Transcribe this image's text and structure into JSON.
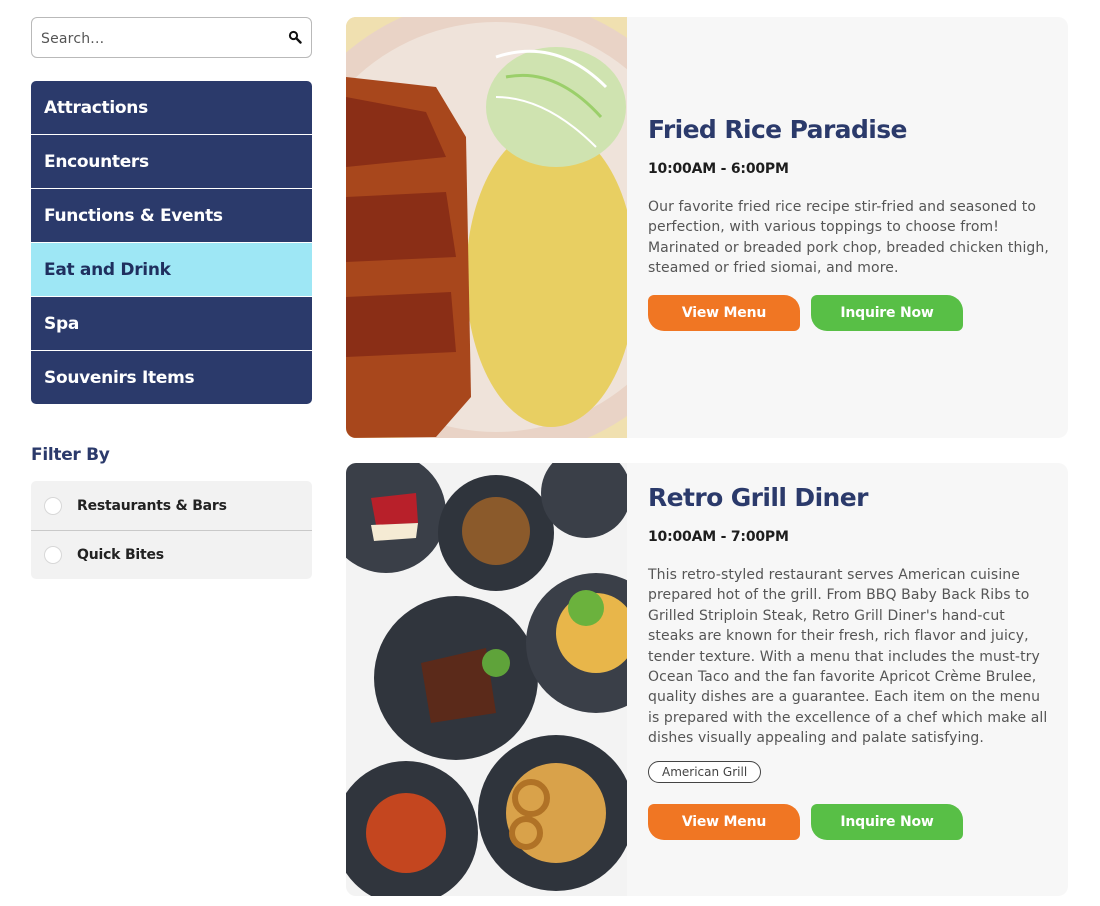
{
  "search": {
    "placeholder": "Search..."
  },
  "nav": {
    "items": [
      {
        "label": "Attractions"
      },
      {
        "label": "Encounters"
      },
      {
        "label": "Functions & Events"
      },
      {
        "label": "Eat and Drink",
        "active": true
      },
      {
        "label": "Spa"
      },
      {
        "label": "Souvenirs Items"
      }
    ]
  },
  "filter": {
    "title": "Filter By",
    "options": [
      {
        "label": "Restaurants & Bars"
      },
      {
        "label": "Quick Bites"
      }
    ]
  },
  "listings": [
    {
      "title": "Fried Rice Paradise",
      "hours": "10:00AM - 6:00PM",
      "description": "Our favorite fried rice recipe stir-fried and seasoned to perfection, with various toppings to choose from! Marinated or breaded pork chop, breaded chicken thigh, steamed or fried siomai, and more.",
      "menu_label": "View Menu",
      "inquire_label": "Inquire Now"
    },
    {
      "title": "Retro Grill Diner",
      "hours": "10:00AM - 7:00PM",
      "description": "This retro-styled restaurant serves American cuisine prepared hot of the grill. From BBQ Baby Back Ribs to Grilled Striploin Steak, Retro Grill Diner's hand-cut steaks are known for their fresh, rich flavor and juicy, tender texture. With a menu that includes the must-try Ocean Taco and the fan favorite Apricot Crème Brulee, quality dishes are a guarantee. Each item on the menu is prepared with the excellence of a chef which make all dishes visually appealing and palate satisfying.",
      "tag": "American Grill",
      "menu_label": "View Menu",
      "inquire_label": "Inquire Now"
    }
  ],
  "colors": {
    "navy": "#2b3a6b",
    "active_nav": "#9ee7f5",
    "orange_button": "#f07623",
    "green_button": "#58bf46"
  }
}
